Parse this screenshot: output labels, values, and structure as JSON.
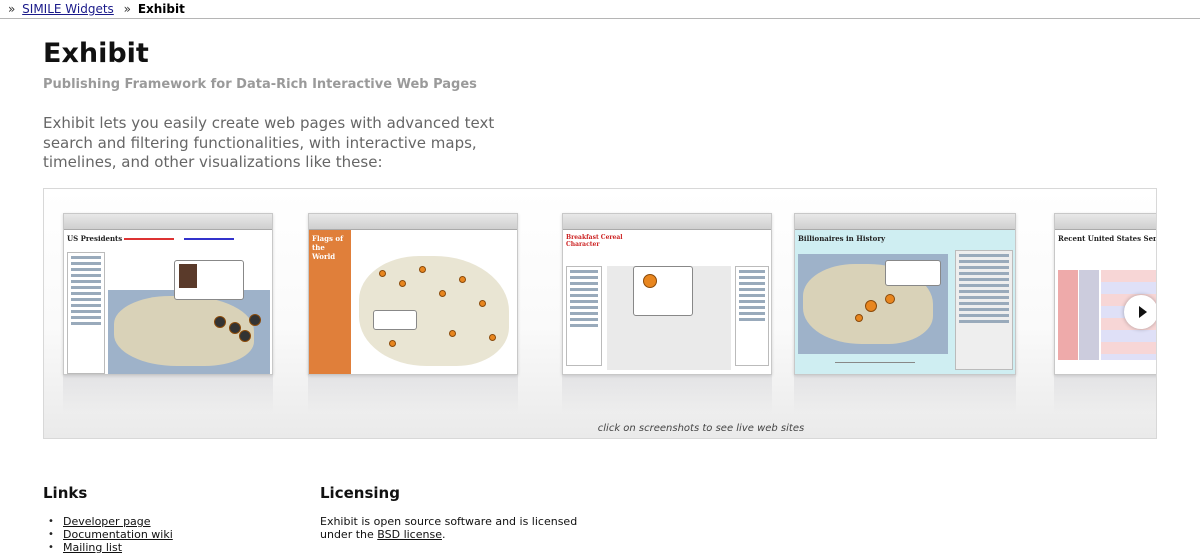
{
  "breadcrumb": {
    "sep1": "»",
    "home_link": "SIMILE Widgets",
    "sep2": "»",
    "current": "Exhibit"
  },
  "header": {
    "title": "Exhibit",
    "subtitle": "Publishing Framework for Data-Rich Interactive Web Pages"
  },
  "intro": "Exhibit lets you easily create web pages with advanced text search and filtering functionalities, with interactive maps, timelines, and other visualizations like these:",
  "gallery": {
    "caption": "click on screenshots to see live web sites",
    "shots": [
      {
        "title": "US Presidents"
      },
      {
        "title": "Flags of the World"
      },
      {
        "title": "Breakfast Cereal Character"
      },
      {
        "title": "Billionaires in History"
      },
      {
        "title": "Recent United States Senate Bills"
      }
    ],
    "next_icon": "chevron-right-icon"
  },
  "links": {
    "heading": "Links",
    "items": [
      "Developer page",
      "Documentation wiki",
      "Mailing list"
    ]
  },
  "licensing": {
    "heading": "Licensing",
    "text_before": "Exhibit is open source software and is licensed under the ",
    "license_link": "BSD license",
    "text_after": "."
  }
}
